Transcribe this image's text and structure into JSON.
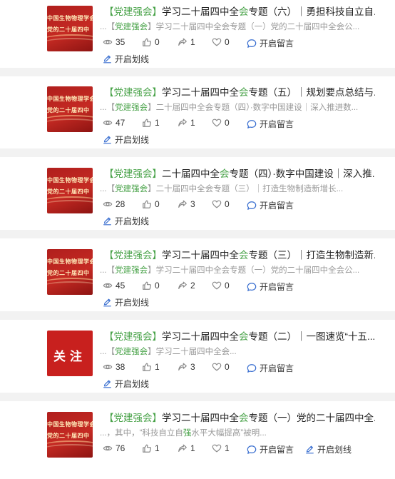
{
  "articles": [
    {
      "thumb": {
        "type": "banner",
        "line1": "中国生物物理学会",
        "line2": "党的二十届四中"
      },
      "title_tag": "【党建强会】",
      "title_pre": "学习二十届四中全",
      "title_hl": "会",
      "title_post": "专题（六）｜勇担科技自立自...",
      "excerpt_pre": "...【",
      "excerpt_tag": "党建强会",
      "excerpt_post": "】学习二十届四中全会专题（一）党的二十届四中全会公...",
      "views": "35",
      "likes": "0",
      "shares": "1",
      "favs": "0",
      "comment_label": "开启留言",
      "underline_label": "开启划线"
    },
    {
      "thumb": {
        "type": "banner",
        "line1": "中国生物物理学会",
        "line2": "党的二十届四中"
      },
      "title_tag": "【党建强会】",
      "title_pre": "学习二十届四中全",
      "title_hl": "会",
      "title_post": "专题（五）｜规划要点总结与...",
      "excerpt_pre": "...【",
      "excerpt_tag": "党建强会",
      "excerpt_post": "】二十届四中全会专题（四）·数字中国建设｜深入推进数...",
      "views": "47",
      "likes": "1",
      "shares": "1",
      "favs": "0",
      "comment_label": "开启留言",
      "underline_label": "开启划线"
    },
    {
      "thumb": {
        "type": "banner",
        "line1": "中国生物物理学会",
        "line2": "党的二十届四中"
      },
      "title_tag": "【党建强会】",
      "title_pre": "二十届四中全",
      "title_hl": "会",
      "title_post": "专题（四）·数字中国建设｜深入推...",
      "excerpt_pre": "...【",
      "excerpt_tag": "党建强会",
      "excerpt_post": "】二十届四中全会专题（三）｜打造生物制造新增长...",
      "views": "28",
      "likes": "0",
      "shares": "3",
      "favs": "0",
      "comment_label": "开启留言",
      "underline_label": "开启划线"
    },
    {
      "thumb": {
        "type": "banner",
        "line1": "中国生物物理学会",
        "line2": "党的二十届四中"
      },
      "title_tag": "【党建强会】",
      "title_pre": "学习二十届四中全",
      "title_hl": "会",
      "title_post": "专题（三）｜打造生物制造新...",
      "excerpt_pre": "...【",
      "excerpt_tag": "党建强会",
      "excerpt_post": "】学习二十届四中全会专题（一）党的二十届四中全会公...",
      "views": "45",
      "likes": "0",
      "shares": "2",
      "favs": "0",
      "comment_label": "开启留言",
      "underline_label": "开启划线"
    },
    {
      "thumb": {
        "type": "follow",
        "text": "关注"
      },
      "title_tag": "【党建强会】",
      "title_pre": "学习二十届四中全",
      "title_hl": "会",
      "title_post": "专题（二）｜一图速览“十五...",
      "excerpt_pre": "...【",
      "excerpt_tag": "党建强会",
      "excerpt_post": "】学习二十届四中全会...",
      "views": "38",
      "likes": "1",
      "shares": "3",
      "favs": "0",
      "comment_label": "开启留言",
      "underline_label": "开启划线"
    },
    {
      "thumb": {
        "type": "banner",
        "line1": "中国生物物理学会",
        "line2": "党的二十届四中"
      },
      "title_tag": "【党建强会】",
      "title_pre": "学习二十届四中全",
      "title_hl": "会",
      "title_post": "专题（一）党的二十届四中全...",
      "excerpt_pre": "...，其中，“科技自立自",
      "excerpt_tag": "强",
      "excerpt_post": "水平大幅提高”被明...",
      "views": "76",
      "likes": "1",
      "shares": "1",
      "favs": "1",
      "comment_label": "开启留言",
      "underline_label": "开启划线"
    }
  ]
}
